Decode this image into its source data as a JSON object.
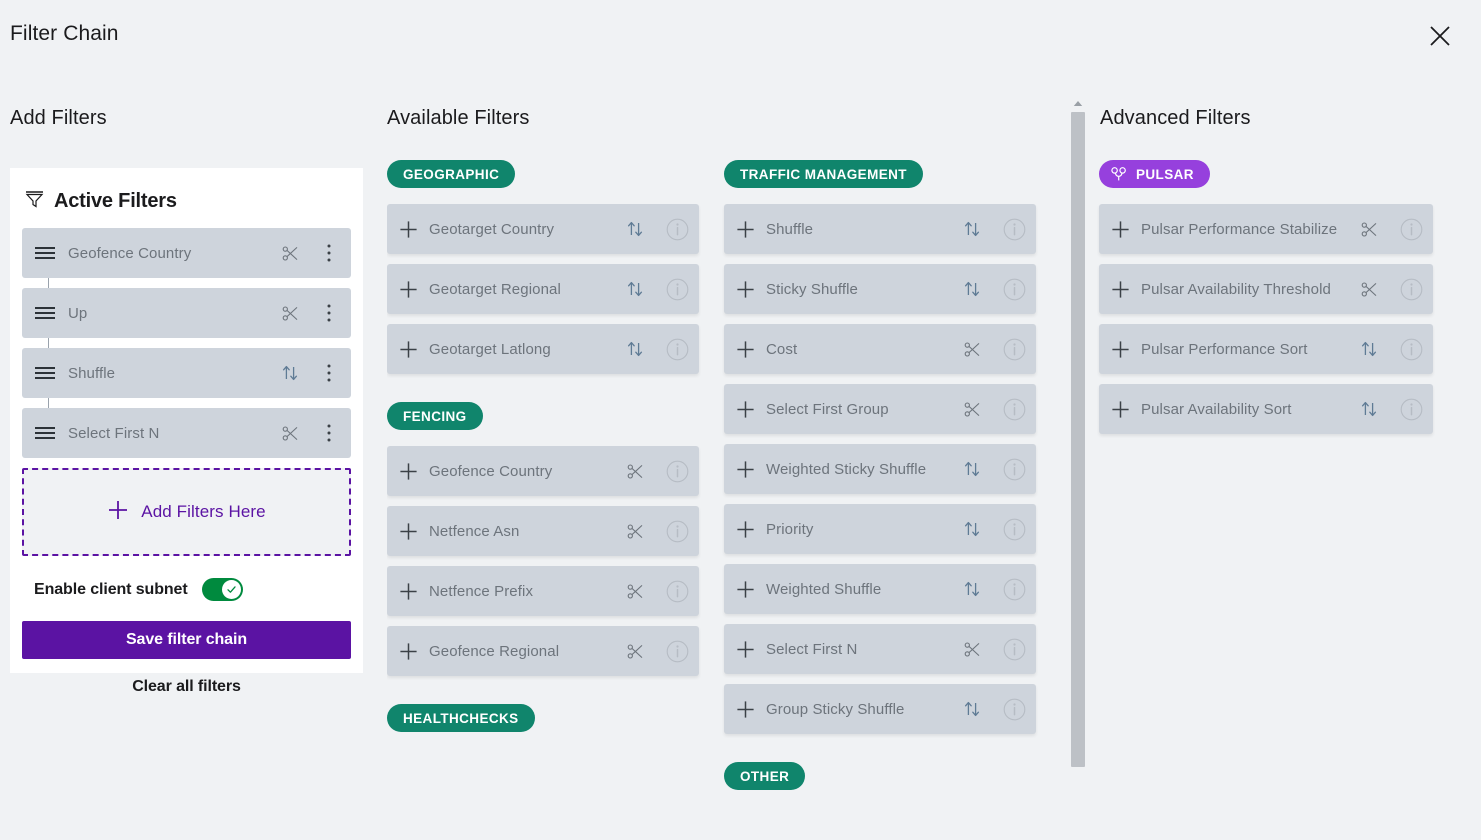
{
  "header": {
    "title": "Filter Chain",
    "close_icon": "close-icon"
  },
  "columns": {
    "add_filters_heading": "Add Filters",
    "available_filters_heading": "Available Filters",
    "advanced_filters_heading": "Advanced Filters"
  },
  "active_panel": {
    "icon": "funnel-icon",
    "title": "Active Filters",
    "rows": [
      {
        "name": "Geofence Country",
        "type_icon": "scissors-icon",
        "menu_icon": "kebab-menu-icon",
        "drag_icon": "drag-handle-icon"
      },
      {
        "name": "Up",
        "type_icon": "scissors-icon",
        "menu_icon": "kebab-menu-icon",
        "drag_icon": "drag-handle-icon"
      },
      {
        "name": "Shuffle",
        "type_icon": "sort-arrows-icon",
        "menu_icon": "kebab-menu-icon",
        "drag_icon": "drag-handle-icon"
      },
      {
        "name": "Select First N",
        "type_icon": "scissors-icon",
        "menu_icon": "kebab-menu-icon",
        "drag_icon": "drag-handle-icon"
      }
    ],
    "dropzone": {
      "label": "Add Filters Here",
      "icon": "plus-icon"
    },
    "subnet": {
      "label": "Enable client subnet",
      "enabled": true,
      "knob_icon": "check-icon"
    },
    "save_label": "Save filter chain",
    "clear_label": "Clear all filters"
  },
  "available": {
    "left_groups": [
      {
        "badge": "GEOGRAPHIC",
        "items": [
          {
            "name": "Geotarget Country",
            "type_icon": "sort-arrows-icon",
            "info_icon": "info-icon",
            "add_icon": "plus-icon"
          },
          {
            "name": "Geotarget Regional",
            "type_icon": "sort-arrows-icon",
            "info_icon": "info-icon",
            "add_icon": "plus-icon"
          },
          {
            "name": "Geotarget Latlong",
            "type_icon": "sort-arrows-icon",
            "info_icon": "info-icon",
            "add_icon": "plus-icon"
          }
        ]
      },
      {
        "badge": "FENCING",
        "items": [
          {
            "name": "Geofence Country",
            "type_icon": "scissors-icon",
            "info_icon": "info-icon",
            "add_icon": "plus-icon"
          },
          {
            "name": "Netfence Asn",
            "type_icon": "scissors-icon",
            "info_icon": "info-icon",
            "add_icon": "plus-icon"
          },
          {
            "name": "Netfence Prefix",
            "type_icon": "scissors-icon",
            "info_icon": "info-icon",
            "add_icon": "plus-icon"
          },
          {
            "name": "Geofence Regional",
            "type_icon": "scissors-icon",
            "info_icon": "info-icon",
            "add_icon": "plus-icon"
          }
        ]
      },
      {
        "badge": "HEALTHCHECKS",
        "items": []
      }
    ],
    "right_groups": [
      {
        "badge": "TRAFFIC MANAGEMENT",
        "items": [
          {
            "name": "Shuffle",
            "type_icon": "sort-arrows-icon",
            "info_icon": "info-icon",
            "add_icon": "plus-icon"
          },
          {
            "name": "Sticky Shuffle",
            "type_icon": "sort-arrows-icon",
            "info_icon": "info-icon",
            "add_icon": "plus-icon"
          },
          {
            "name": "Cost",
            "type_icon": "scissors-icon",
            "info_icon": "info-icon",
            "add_icon": "plus-icon"
          },
          {
            "name": "Select First Group",
            "type_icon": "scissors-icon",
            "info_icon": "info-icon",
            "add_icon": "plus-icon"
          },
          {
            "name": "Weighted Sticky Shuffle",
            "type_icon": "sort-arrows-icon",
            "info_icon": "info-icon",
            "add_icon": "plus-icon"
          },
          {
            "name": "Priority",
            "type_icon": "sort-arrows-icon",
            "info_icon": "info-icon",
            "add_icon": "plus-icon"
          },
          {
            "name": "Weighted Shuffle",
            "type_icon": "sort-arrows-icon",
            "info_icon": "info-icon",
            "add_icon": "plus-icon"
          },
          {
            "name": "Select First N",
            "type_icon": "scissors-icon",
            "info_icon": "info-icon",
            "add_icon": "plus-icon"
          },
          {
            "name": "Group Sticky Shuffle",
            "type_icon": "sort-arrows-icon",
            "info_icon": "info-icon",
            "add_icon": "plus-icon"
          }
        ]
      },
      {
        "badge": "OTHER",
        "items": []
      }
    ]
  },
  "advanced": {
    "groups": [
      {
        "badge": "PULSAR",
        "badge_icon": "pulsar-icon",
        "items": [
          {
            "name": "Pulsar Performance Stabilize",
            "type_icon": "scissors-icon",
            "info_icon": "info-icon",
            "add_icon": "plus-icon"
          },
          {
            "name": "Pulsar Availability Threshold",
            "type_icon": "scissors-icon",
            "info_icon": "info-icon",
            "add_icon": "plus-icon"
          },
          {
            "name": "Pulsar Performance Sort",
            "type_icon": "sort-arrows-icon",
            "info_icon": "info-icon",
            "add_icon": "plus-icon"
          },
          {
            "name": "Pulsar Availability Sort",
            "type_icon": "sort-arrows-icon",
            "info_icon": "info-icon",
            "add_icon": "plus-icon"
          }
        ]
      }
    ]
  },
  "scrollbar": {
    "arrow_icon": "scroll-up-arrow-icon"
  },
  "colors": {
    "background": "#f0f2f4",
    "card": "#ced4dc",
    "badge_teal": "#10856c",
    "badge_purple": "#9640dd",
    "accent_purple": "#5b13a3",
    "toggle_green": "#008a3e",
    "muted_text": "#6d747c"
  }
}
